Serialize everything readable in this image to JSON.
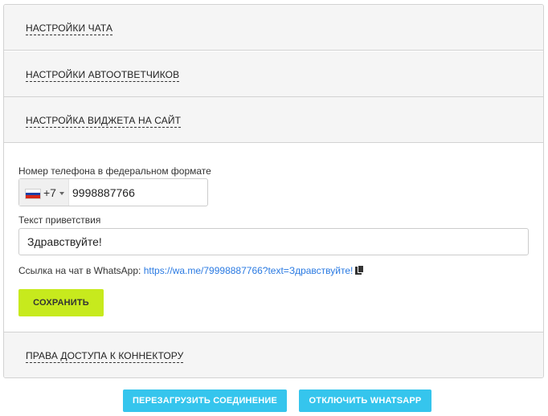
{
  "sections": {
    "chat_settings": "Настройки чата",
    "autoresponder_settings": "Настройки автоответчиков",
    "widget_settings": "Настройка виджета на сайт",
    "access_rights": "Права доступа к коннектору"
  },
  "widget": {
    "phone_label": "Номер телефона в федеральном формате",
    "dial_code": "+7",
    "phone_value": "9998887766",
    "greeting_label": "Текст приветствия",
    "greeting_value": "Здравствуйте!",
    "link_prefix": "Ссылка на чат в WhatsApp:",
    "link_url": "https://wa.me/79998887766?text=Здравствуйте!",
    "save_label": "СОХРАНИТЬ"
  },
  "footer": {
    "reload_label": "ПЕРЕЗАГРУЗИТЬ СОЕДИНЕНИЕ",
    "disconnect_label": "ОТКЛЮЧИТЬ WHATSAPP"
  },
  "colors": {
    "save_button": "#c7ea1d",
    "action_button": "#35c5ed",
    "link": "#2a7ae2"
  },
  "icons": {
    "flag": "russia-flag-icon",
    "copy": "copy-icon"
  }
}
